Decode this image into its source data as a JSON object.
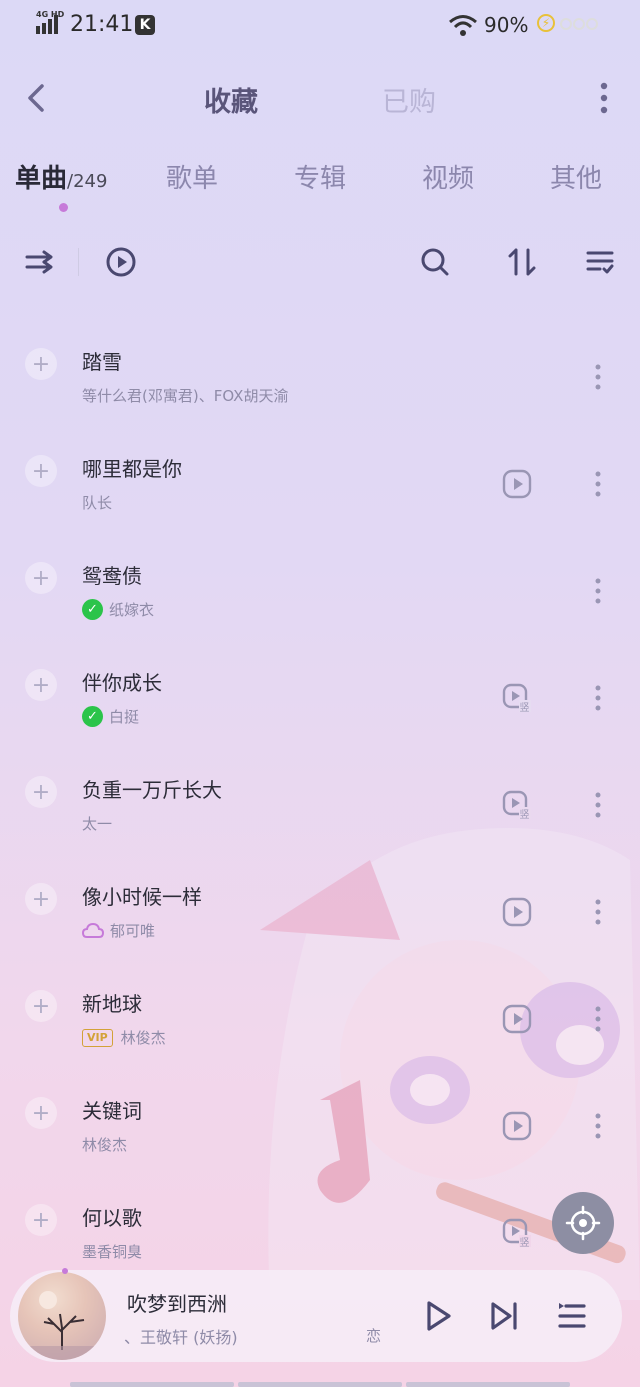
{
  "status_bar": {
    "network": "4G HD",
    "time": "21:41",
    "app_badge": "K",
    "battery": "90%"
  },
  "header": {
    "tab_active": "收藏",
    "tab_inactive": "已购"
  },
  "categories": {
    "items": [
      {
        "label": "单曲",
        "count": "/249",
        "active": true
      },
      {
        "label": "歌单"
      },
      {
        "label": "专辑"
      },
      {
        "label": "视频"
      },
      {
        "label": "其他"
      }
    ]
  },
  "toolbar": {
    "icons": [
      "shuffle-icon",
      "play-all-icon",
      "search-icon",
      "sort-icon",
      "manage-list-icon"
    ]
  },
  "songs": [
    {
      "title": "踏雪",
      "artist": "等什么君(邓寓君)、FOX胡天渝",
      "badge": "",
      "mv": ""
    },
    {
      "title": "哪里都是你",
      "artist": "队长",
      "badge": "",
      "mv": "video"
    },
    {
      "title": "鸳鸯债",
      "artist": "纸嫁衣",
      "badge": "check",
      "mv": ""
    },
    {
      "title": "伴你成长",
      "artist": "白挺",
      "badge": "check",
      "mv": "vertical"
    },
    {
      "title": "负重一万斤长大",
      "artist": "太一",
      "badge": "",
      "mv": "vertical"
    },
    {
      "title": "像小时候一样",
      "artist": "郁可唯",
      "badge": "cloud",
      "mv": "video"
    },
    {
      "title": "新地球",
      "artist": "林俊杰",
      "badge": "vip",
      "badge_text": "VIP",
      "mv": "video"
    },
    {
      "title": "关键词",
      "artist": "林俊杰",
      "badge": "",
      "mv": "video"
    },
    {
      "title": "何以歌",
      "artist": "墨香铜臭",
      "badge": "",
      "mv": "vertical"
    }
  ],
  "now_playing": {
    "title": "吹梦到西洲",
    "artist": "、王敬轩 (妖扬)",
    "lyric": "恋"
  },
  "colors": {
    "accent": "#c67ad9",
    "icon": "#4a4870",
    "check_badge": "#2bc44a",
    "vip_badge": "#d3a238"
  }
}
